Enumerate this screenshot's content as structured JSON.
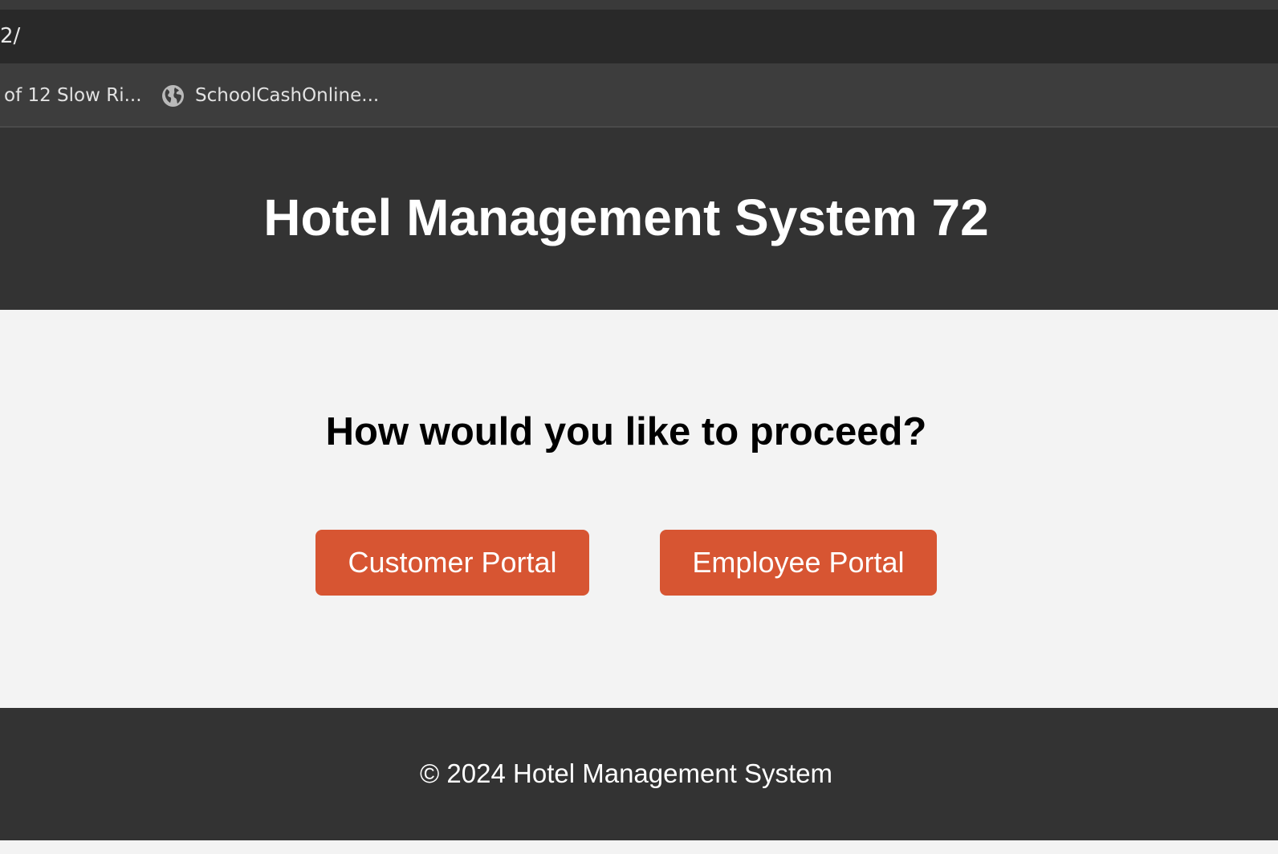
{
  "browser": {
    "address_text": "2/",
    "bookmarks": [
      {
        "label": "of 12 Slow Ri..."
      },
      {
        "label": "SchoolCashOnline...",
        "icon": "globe-icon"
      }
    ]
  },
  "header": {
    "title": "Hotel Management System 72"
  },
  "main": {
    "prompt": "How would you like to proceed?",
    "buttons": {
      "customer_label": "Customer Portal",
      "employee_label": "Employee Portal"
    }
  },
  "footer": {
    "text": "© 2024 Hotel Management System"
  },
  "colors": {
    "header_bg": "#333333",
    "body_bg": "#f3f3f3",
    "button_bg": "#d75532",
    "button_text": "#ffffff"
  }
}
